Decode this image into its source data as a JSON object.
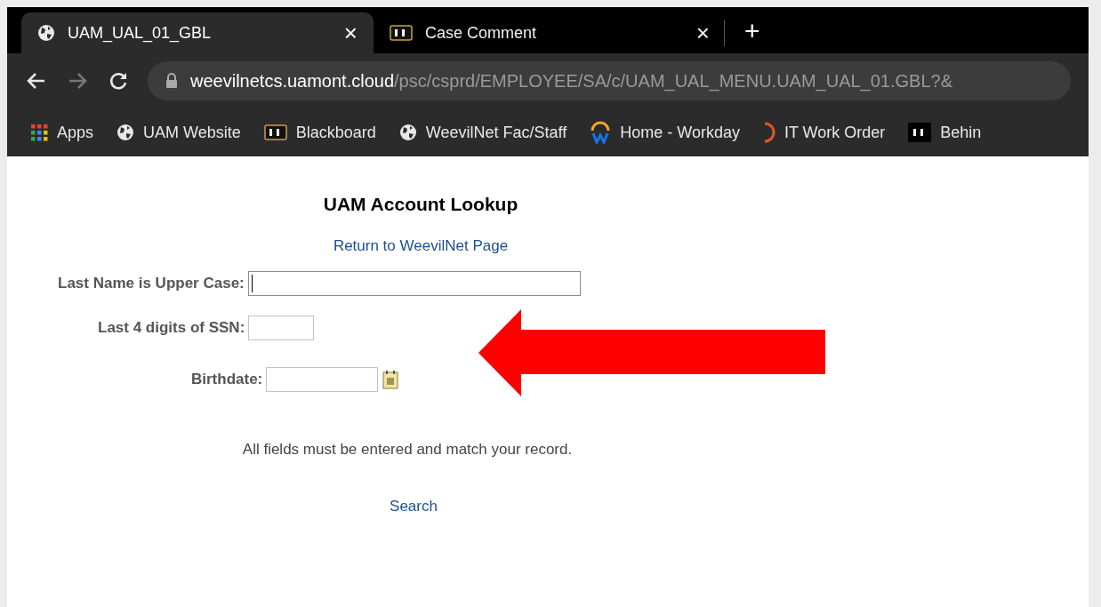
{
  "tabs": [
    {
      "title": "UAM_UAL_01_GBL",
      "kind": "globe",
      "selected": true,
      "close": "×"
    },
    {
      "title": "Case Comment",
      "kind": "bb",
      "selected": false,
      "close": "×"
    }
  ],
  "new_tab": "+",
  "address": {
    "host": "weevilnetcs.uamont.cloud",
    "path": "/psc/csprd/EMPLOYEE/SA/c/UAM_UAL_MENU.UAM_UAL_01.GBL?&"
  },
  "bookmarks": [
    {
      "label": "Apps",
      "kind": "apps"
    },
    {
      "label": "UAM Website",
      "kind": "globe"
    },
    {
      "label": "Blackboard",
      "kind": "bb"
    },
    {
      "label": "WeevilNet Fac/Staff",
      "kind": "globe"
    },
    {
      "label": "Home - Workday",
      "kind": "workday"
    },
    {
      "label": "IT Work Order",
      "kind": "ring"
    },
    {
      "label": "Behin",
      "kind": "bb-dark"
    }
  ],
  "page": {
    "title": "UAM Account Lookup",
    "return_link": "Return to WeevilNet Page",
    "fields": [
      {
        "label": "Last Name is Upper Case:",
        "kind": "text",
        "focused": true
      },
      {
        "label": "Last 4 digits of SSN:",
        "kind": "short",
        "focused": false
      },
      {
        "label": "Birthdate:",
        "kind": "date",
        "focused": false
      }
    ],
    "note": "All fields must be entered and match your record.",
    "search_link": "Search"
  }
}
